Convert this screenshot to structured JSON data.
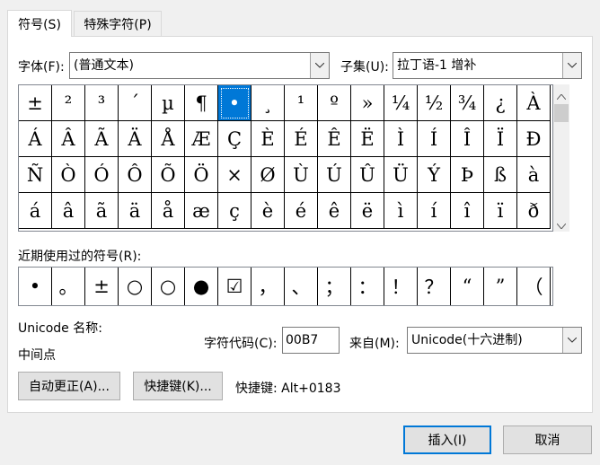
{
  "tabs": [
    "符号(S)",
    "特殊字符(P)"
  ],
  "font_label": "字体(F):",
  "font_value": "(普通文本)",
  "subset_label": "子集(U):",
  "subset_value": "拉丁语-1 增补",
  "symbols": [
    [
      "±",
      "²",
      "³",
      "´",
      "µ",
      "¶",
      "•",
      "¸",
      "¹",
      "º",
      "»",
      "¼",
      "½",
      "¾",
      "¿",
      "À"
    ],
    [
      "Á",
      "Â",
      "Ã",
      "Ä",
      "Å",
      "Æ",
      "Ç",
      "È",
      "É",
      "Ê",
      "Ë",
      "Ì",
      "Í",
      "Î",
      "Ï",
      "Ð"
    ],
    [
      "Ñ",
      "Ò",
      "Ó",
      "Ô",
      "Õ",
      "Ö",
      "×",
      "Ø",
      "Ù",
      "Ú",
      "Û",
      "Ü",
      "Ý",
      "Þ",
      "ß",
      "à"
    ],
    [
      "á",
      "â",
      "ã",
      "ä",
      "å",
      "æ",
      "ç",
      "è",
      "é",
      "ê",
      "ë",
      "ì",
      "í",
      "î",
      "ï",
      "ð"
    ]
  ],
  "selected_symbol": "•",
  "recent_label": "近期使用过的符号(R):",
  "recent_symbols": [
    "•",
    "。",
    "±",
    "○",
    "○",
    "●",
    "☑",
    "，",
    "、",
    "；",
    "：",
    "！",
    "？",
    "“",
    "”",
    "（"
  ],
  "unicode_name_label": "Unicode 名称:",
  "unicode_name_value": "中间点",
  "char_code_label": "字符代码(C):",
  "char_code_value": "00B7",
  "from_label": "来自(M):",
  "from_value": "Unicode(十六进制)",
  "autocorrect_button": "自动更正(A)...",
  "shortcut_button": "快捷键(K)...",
  "shortcut_text": "快捷键: Alt+0183",
  "insert_button": "插入(I)",
  "cancel_button": "取消",
  "icons": {
    "dropdown": "chevron-down-icon",
    "scroll_up": "scroll-up-arrow-icon",
    "scroll_down": "scroll-down-arrow-icon"
  },
  "colors": {
    "selection": "#0078d7",
    "default_button_border": "#0078d7"
  }
}
